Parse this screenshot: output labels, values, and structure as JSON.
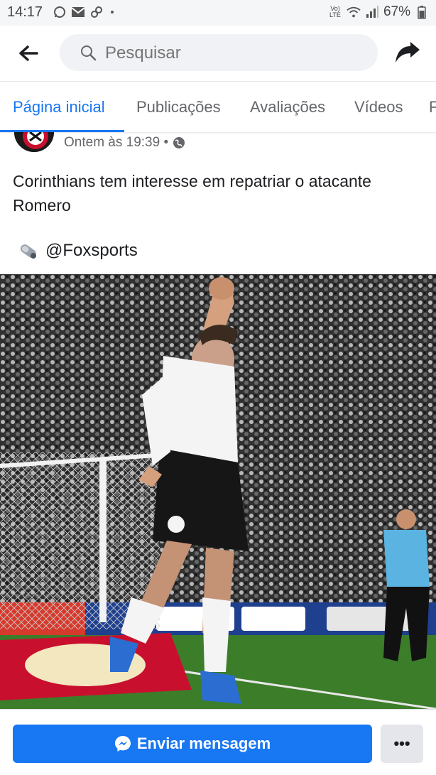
{
  "status_bar": {
    "time": "14:17",
    "left_icons": [
      "whatsapp-icon",
      "gmail-icon",
      "link-icon"
    ],
    "network_label": "Vo) LTE",
    "battery": "67%"
  },
  "search": {
    "placeholder": "Pesquisar"
  },
  "tabs": [
    {
      "label": "Página inicial",
      "active": true
    },
    {
      "label": "Publicações",
      "active": false
    },
    {
      "label": "Avaliações",
      "active": false
    },
    {
      "label": "Vídeos",
      "active": false
    },
    {
      "label": "F",
      "active": false
    }
  ],
  "post": {
    "timestamp": "Ontem às 19:39 •",
    "text": "Corinthians tem interesse em repatriar o atacante Romero",
    "source": "@Foxsports"
  },
  "bottom_bar": {
    "message_button": "Enviar mensagem",
    "more_button": "•••"
  },
  "colors": {
    "accent": "#1877f2",
    "secondary_text": "#65676b"
  }
}
